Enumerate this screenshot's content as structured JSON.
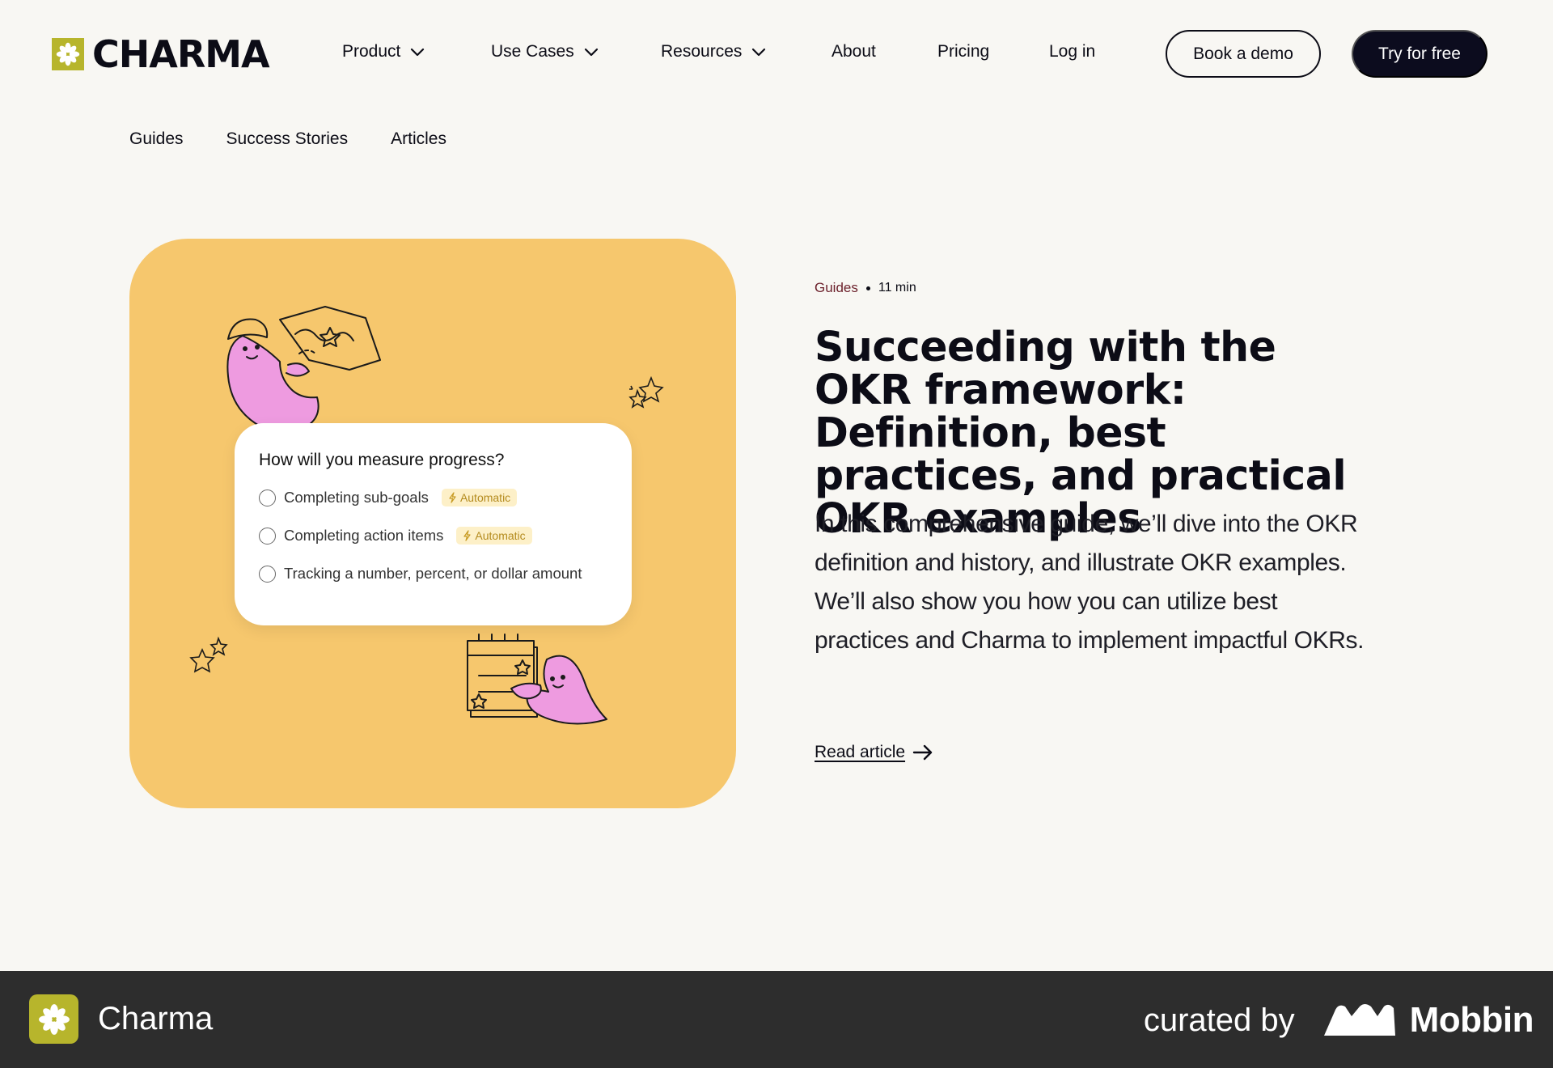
{
  "brand": {
    "name": "CHARMA",
    "logo_icon": "asterisk-star-icon",
    "accent": "#b7b52c"
  },
  "nav": {
    "product": "Product",
    "use_cases": "Use Cases",
    "resources": "Resources",
    "about": "About",
    "pricing": "Pricing",
    "login": "Log in",
    "book_demo": "Book a demo",
    "try_free": "Try for free"
  },
  "subnav": {
    "guides": "Guides",
    "success_stories": "Success Stories",
    "articles": "Articles"
  },
  "hero": {
    "card_color": "#f6c76d",
    "question": "How will you measure progress?",
    "options": [
      {
        "label": "Completing sub-goals",
        "tag": "Automatic"
      },
      {
        "label": "Completing action items",
        "tag": "Automatic"
      },
      {
        "label": "Tracking a number, percent, or dollar amount"
      }
    ]
  },
  "article": {
    "category": "Guides",
    "read_time": "11 min",
    "title": "Succeeding with the OKR framework: Definition, best practices, and practical OKR examples",
    "description": "In this comprehensive guide, we’ll dive into the OKR definition and history, and illustrate OKR examples. We’ll also show you how you can utilize best practices and Charma to implement impactful OKRs.",
    "read_link": "Read article"
  },
  "footer": {
    "app_name": "Charma",
    "curated_by": "curated by",
    "curator": "Mobbin",
    "bar_color": "#2d2d2d"
  }
}
